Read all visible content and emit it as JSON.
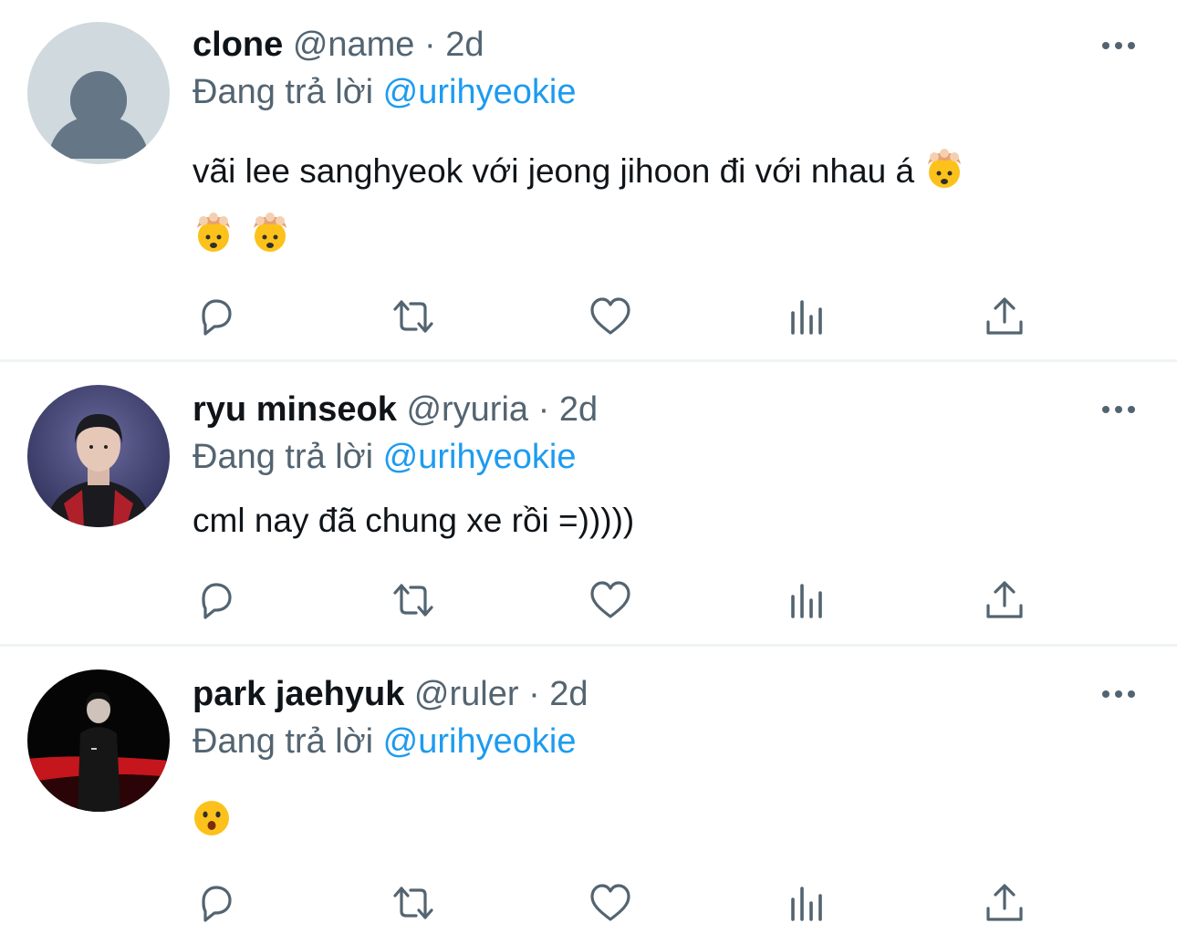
{
  "tweets": [
    {
      "name": "clone",
      "handle": "@name",
      "dot": "·",
      "time": "2d",
      "reply_prefix": "Đang trả lời",
      "reply_mention": "@urihyeokie",
      "text_line1": "vãi lee sanghyeok với jeong jihoon đi với nhau á",
      "emoji_line1": [
        "exploding-head"
      ],
      "emoji_line2": [
        "exploding-head",
        "exploding-head"
      ],
      "avatar": "default-avatar"
    },
    {
      "name": "ryu minseok",
      "handle": "@ryuria",
      "dot": "·",
      "time": "2d",
      "reply_prefix": "Đang trả lời",
      "reply_mention": "@urihyeokie",
      "text_line1": "cml nay đã chung xe rồi =)))))",
      "avatar": "photo-avatar"
    },
    {
      "name": "park jaehyuk",
      "handle": "@ruler",
      "dot": "·",
      "time": "2d",
      "reply_prefix": "Đang trả lời",
      "reply_mention": "@urihyeokie",
      "emoji_line1": [
        "hushed-face"
      ],
      "avatar": "photo-avatar"
    }
  ],
  "action_icons": [
    "reply-icon",
    "retweet-icon",
    "like-icon",
    "analytics-icon",
    "share-icon"
  ],
  "colors": {
    "text": "#0f1419",
    "secondary": "#536471",
    "link": "#1d9bf0",
    "divider": "#eff3f4"
  }
}
